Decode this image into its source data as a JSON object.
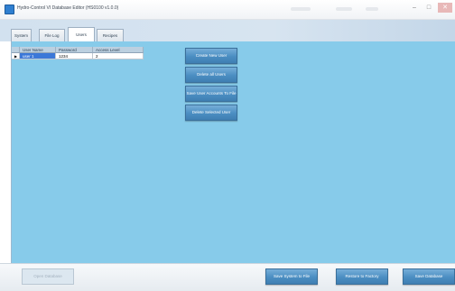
{
  "window": {
    "title": "Hydro-Control VI Database Editor (HS0100 v1.0.0)"
  },
  "tabs": [
    {
      "label": "System"
    },
    {
      "label": "File Log"
    },
    {
      "label": "Users",
      "active": true
    },
    {
      "label": "Recipes"
    }
  ],
  "users_table": {
    "columns": [
      "",
      "User Name",
      "Password",
      "Access Level"
    ],
    "rows": [
      {
        "indicator": "▶",
        "user_name": "user 1",
        "password": "1234",
        "access_level": "2"
      }
    ]
  },
  "actions": {
    "create_new_user": "Create New User",
    "delete_all_users": "Delete all Users",
    "save_user_accounts": "Save User Accounts To File",
    "delete_selected_user": "Delete Selected User"
  },
  "bottom": {
    "open_database": "Open Database",
    "save_system_to_file": "Save System to File",
    "restore_to_factory": "Restore to Factory",
    "save_database": "Save Database"
  },
  "colors": {
    "panel_background": "#87cbea",
    "button_blue": "#4b8ec2",
    "selection": "#3b78d8"
  }
}
